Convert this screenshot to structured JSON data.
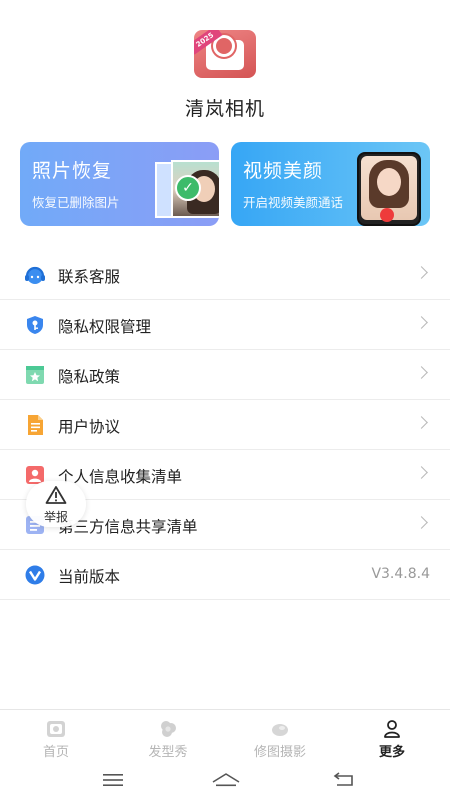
{
  "app": {
    "name": "清岚相机",
    "logo_badge": "2025"
  },
  "banners": {
    "photo_recovery": {
      "title": "照片恢复",
      "subtitle": "恢复已删除图片"
    },
    "video_beauty": {
      "title": "视频美颜",
      "subtitle": "开启视频美颜通话"
    }
  },
  "menu": {
    "items": [
      {
        "label": "联系客服",
        "icon": "headset-icon"
      },
      {
        "label": "隐私权限管理",
        "icon": "shield-key-icon"
      },
      {
        "label": "隐私政策",
        "icon": "bookmark-star-icon"
      },
      {
        "label": "用户协议",
        "icon": "document-icon"
      },
      {
        "label": "个人信息收集清单",
        "icon": "person-card-icon"
      },
      {
        "label": "第三方信息共享清单",
        "icon": "list-icon"
      },
      {
        "label": "当前版本",
        "icon": "version-v-icon",
        "value": "V3.4.8.4"
      }
    ]
  },
  "report": {
    "label": "举报"
  },
  "tabs": [
    {
      "label": "首页",
      "active": false
    },
    {
      "label": "发型秀",
      "active": false
    },
    {
      "label": "修图摄影",
      "active": false
    },
    {
      "label": "更多",
      "active": true
    }
  ],
  "colors": {
    "photo_banner": "#7FA4F7",
    "video_banner": "#4BB3F5",
    "active_tab": "#222222",
    "inactive_tab": "#B5B5B5"
  }
}
